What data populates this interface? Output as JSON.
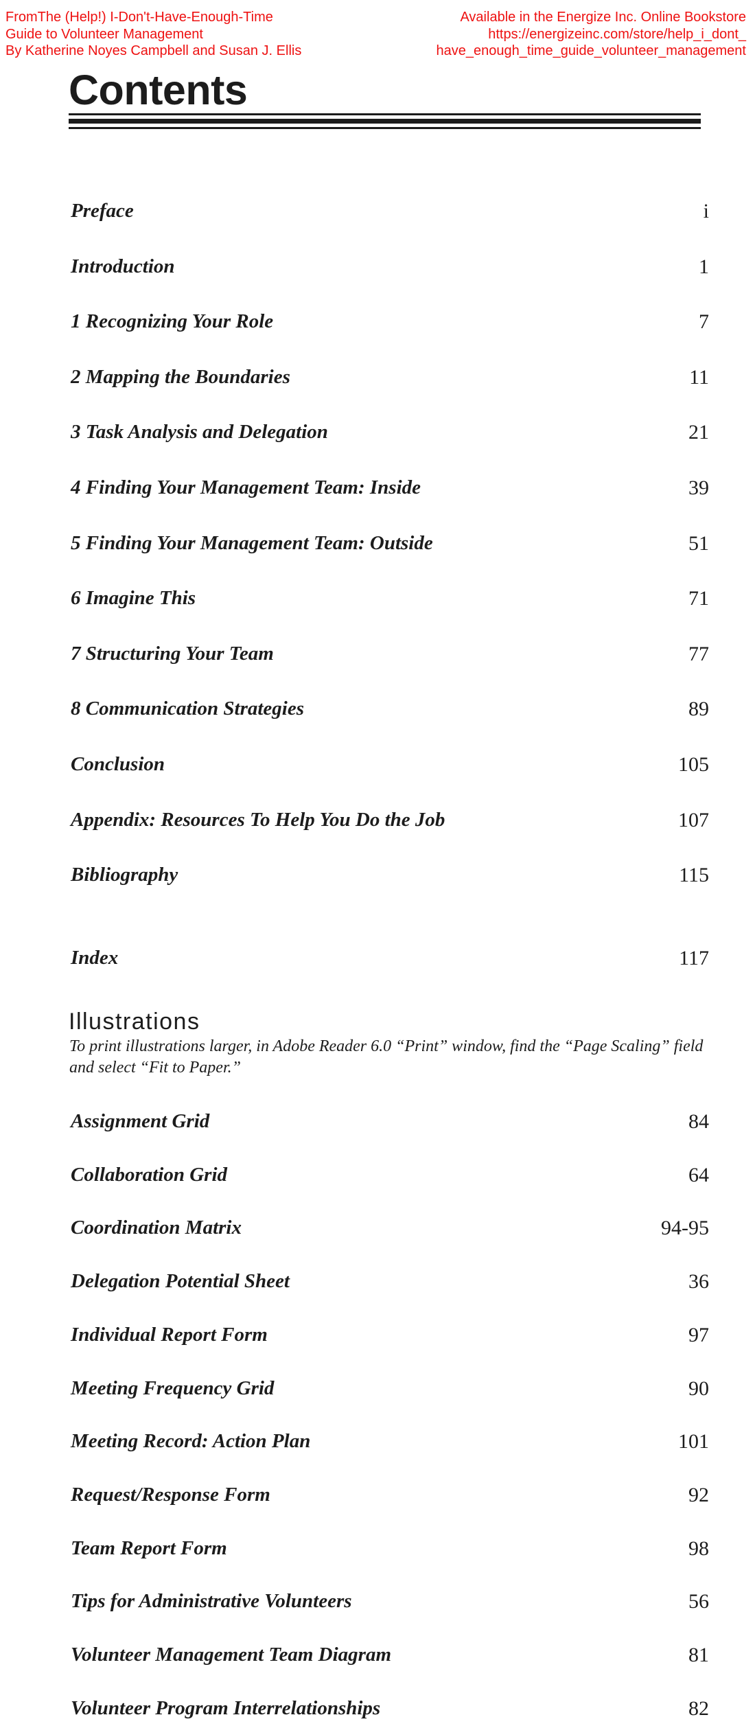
{
  "header": {
    "left_lines": [
      "FromThe (Help!) I-Don't-Have-Enough-Time",
      "Guide to Volunteer Management",
      "By Katherine Noyes Campbell and Susan J. Ellis"
    ],
    "right_lines": [
      "Available in the Energize Inc. Online Bookstore",
      "https://energizeinc.com/store/help_i_dont_",
      "have_enough_time_guide_volunteer_management"
    ],
    "color": "#ee1111"
  },
  "title": "Contents",
  "contents": [
    {
      "label": "Preface",
      "page": "i"
    },
    {
      "label": "Introduction",
      "page": "1"
    },
    {
      "label": "1 Recognizing Your Role",
      "page": "7"
    },
    {
      "label": "2 Mapping the Boundaries",
      "page": "11"
    },
    {
      "label": "3 Task Analysis and Delegation",
      "page": "21"
    },
    {
      "label": "4 Finding Your Management Team: Inside",
      "page": "39"
    },
    {
      "label": "5 Finding Your Management Team: Outside",
      "page": "51"
    },
    {
      "label": "6 Imagine This",
      "page": "71"
    },
    {
      "label": "7 Structuring Your Team",
      "page": "77"
    },
    {
      "label": "8 Communication Strategies",
      "page": "89"
    },
    {
      "label": "Conclusion",
      "page": "105"
    },
    {
      "label": "Appendix: Resources To Help You Do the Job",
      "page": "107"
    },
    {
      "label": "Bibliography",
      "page": "115"
    },
    {
      "label": "Index",
      "page": "117"
    }
  ],
  "illustrations": {
    "heading": "Illustrations",
    "note": "To print illustrations larger, in Adobe Reader 6.0 “Print” window, find the “Page Scaling” field and select “Fit to Paper.”",
    "items": [
      {
        "label": "Assignment Grid",
        "page": "84"
      },
      {
        "label": "Collaboration Grid",
        "page": "64"
      },
      {
        "label": "Coordination Matrix",
        "page": "94-95"
      },
      {
        "label": "Delegation Potential Sheet",
        "page": "36"
      },
      {
        "label": "Individual Report Form",
        "page": "97"
      },
      {
        "label": "Meeting Frequency Grid",
        "page": "90"
      },
      {
        "label": "Meeting Record: Action Plan",
        "page": "101"
      },
      {
        "label": "Request/Response Form",
        "page": "92"
      },
      {
        "label": "Team Report Form",
        "page": "98"
      },
      {
        "label": "Tips for Administrative Volunteers",
        "page": "56"
      },
      {
        "label": "Volunteer Management Team Diagram",
        "page": "81"
      },
      {
        "label": "Volunteer Program Interrelationships",
        "page": "82"
      }
    ]
  }
}
